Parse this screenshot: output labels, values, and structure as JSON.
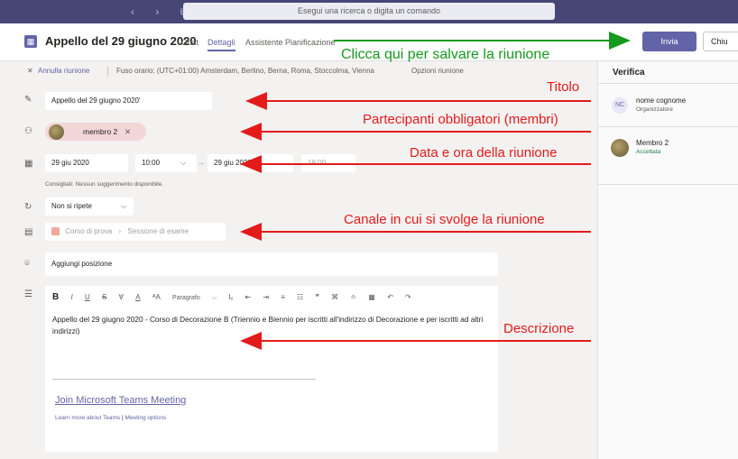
{
  "topbar": {
    "command_placeholder": "Esegui una ricerca o digita un comando"
  },
  "header": {
    "title": "Appello del 29 giugno 2020",
    "tabs": [
      "Chat",
      "Dettagli",
      "Assistente Pianificazione"
    ],
    "send_label": "Invia",
    "close_label": "Chiu"
  },
  "subbar": {
    "cancel_label": "Annulla riunione",
    "timezone": "Fuso orario: (UTC+01:00) Amsterdam, Berlino, Berna, Roma, Stoccolma, Vienna",
    "options_label": "Opzioni riunione"
  },
  "form": {
    "title_value": "Appello del 29 giugno 2020'",
    "attendee": "membro 2",
    "start_date": "29 giu 2020",
    "start_time": "10:00",
    "end_date": "29 giu 2020",
    "end_time": "18:00",
    "suggestion_hint": "Consigliati: Nessun suggerimento disponibile.",
    "repeat": "Non si ripete",
    "channel_team": "Corso di prova",
    "channel_name": "Sessione di esame",
    "location_placeholder": "Aggiungi posizione"
  },
  "editor": {
    "paragraph_label": "Paragrafo",
    "description": "Appello del 29 giugno 2020 - Corso di Decorazione B (Triennio e Biennio per iscritti all'indirizzo di Decorazione e per iscritti ad altri indirizzi)",
    "join_link": "Join Microsoft Teams Meeting",
    "learn_more": "Learn more about Teams",
    "meeting_options": "Meeting options"
  },
  "panel": {
    "title": "Verifica",
    "organizer_initials": "NC",
    "organizer_name": "nome cognome",
    "organizer_role": "Organizzatore",
    "member_name": "Membro 2",
    "member_status": "Accettata"
  },
  "annotations": {
    "save": "Clicca qui per salvare la riunione",
    "title": "Titolo",
    "attendees": "Partecipanti obbligatori (membri)",
    "datetime": "Data e ora della riunione",
    "channel": "Canale in cui si svolge la riunione",
    "description": "Descrizione"
  },
  "colors": {
    "accent": "#6264a7",
    "annotation_red": "#e31b1b",
    "annotation_green": "#159a1e",
    "topbar": "#464775"
  }
}
